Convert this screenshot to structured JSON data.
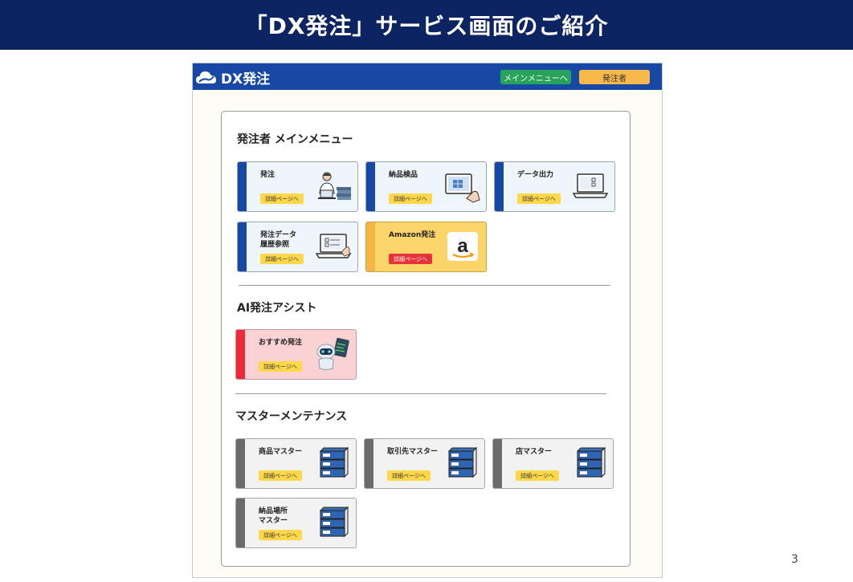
{
  "slide": {
    "title": "「DX発注」サービス画面のご紹介",
    "page_number": "3"
  },
  "app": {
    "brand": "DX発注",
    "topbar_buttons": {
      "main_menu": "メインメニューへ",
      "orderer": "発注者"
    }
  },
  "sections": {
    "orderer_menu": {
      "heading": "発注者 メインメニュー",
      "cards": [
        {
          "title": "発注",
          "button": "詳細ページへ",
          "illustration": "person-at-laptop-icon"
        },
        {
          "title": "納品検品",
          "button": "詳細ページへ",
          "illustration": "tablet-inspection-icon"
        },
        {
          "title": "データ出力",
          "button": "詳細ページへ",
          "illustration": "laptop-export-icon"
        },
        {
          "title": "発注データ\n履歴参照",
          "button": "詳細ページへ",
          "illustration": "laptop-history-icon"
        },
        {
          "title": "Amazon発注",
          "button": "詳細ページへ",
          "illustration": "amazon-logo-icon"
        }
      ]
    },
    "ai_assist": {
      "heading": "AI発注アシスト",
      "cards": [
        {
          "title": "おすすめ発注",
          "button": "詳細ページへ",
          "illustration": "robot-icon"
        }
      ]
    },
    "master_maintenance": {
      "heading": "マスターメンテナンス",
      "cards": [
        {
          "title": "商品マスター",
          "button": "詳細ページへ",
          "illustration": "server-icon"
        },
        {
          "title": "取引先マスター",
          "button": "詳細ページへ",
          "illustration": "server-icon"
        },
        {
          "title": "店マスター",
          "button": "詳細ページへ",
          "illustration": "server-icon"
        },
        {
          "title": "納品場所\nマスター",
          "button": "詳細ページへ",
          "illustration": "server-icon"
        }
      ]
    }
  },
  "colors": {
    "slide_header": "#0d2463",
    "app_topbar": "#1748a6",
    "main_menu_button": "#27a35a",
    "orderer_button": "#f8b94a",
    "detail_button": "#ffd84a",
    "amazon_card": "#fcd56a",
    "amazon_button": "#e8323a",
    "ai_card": "#fbd2d3",
    "ai_bar": "#ee2a3a",
    "master_bar": "#6b6b6b"
  }
}
